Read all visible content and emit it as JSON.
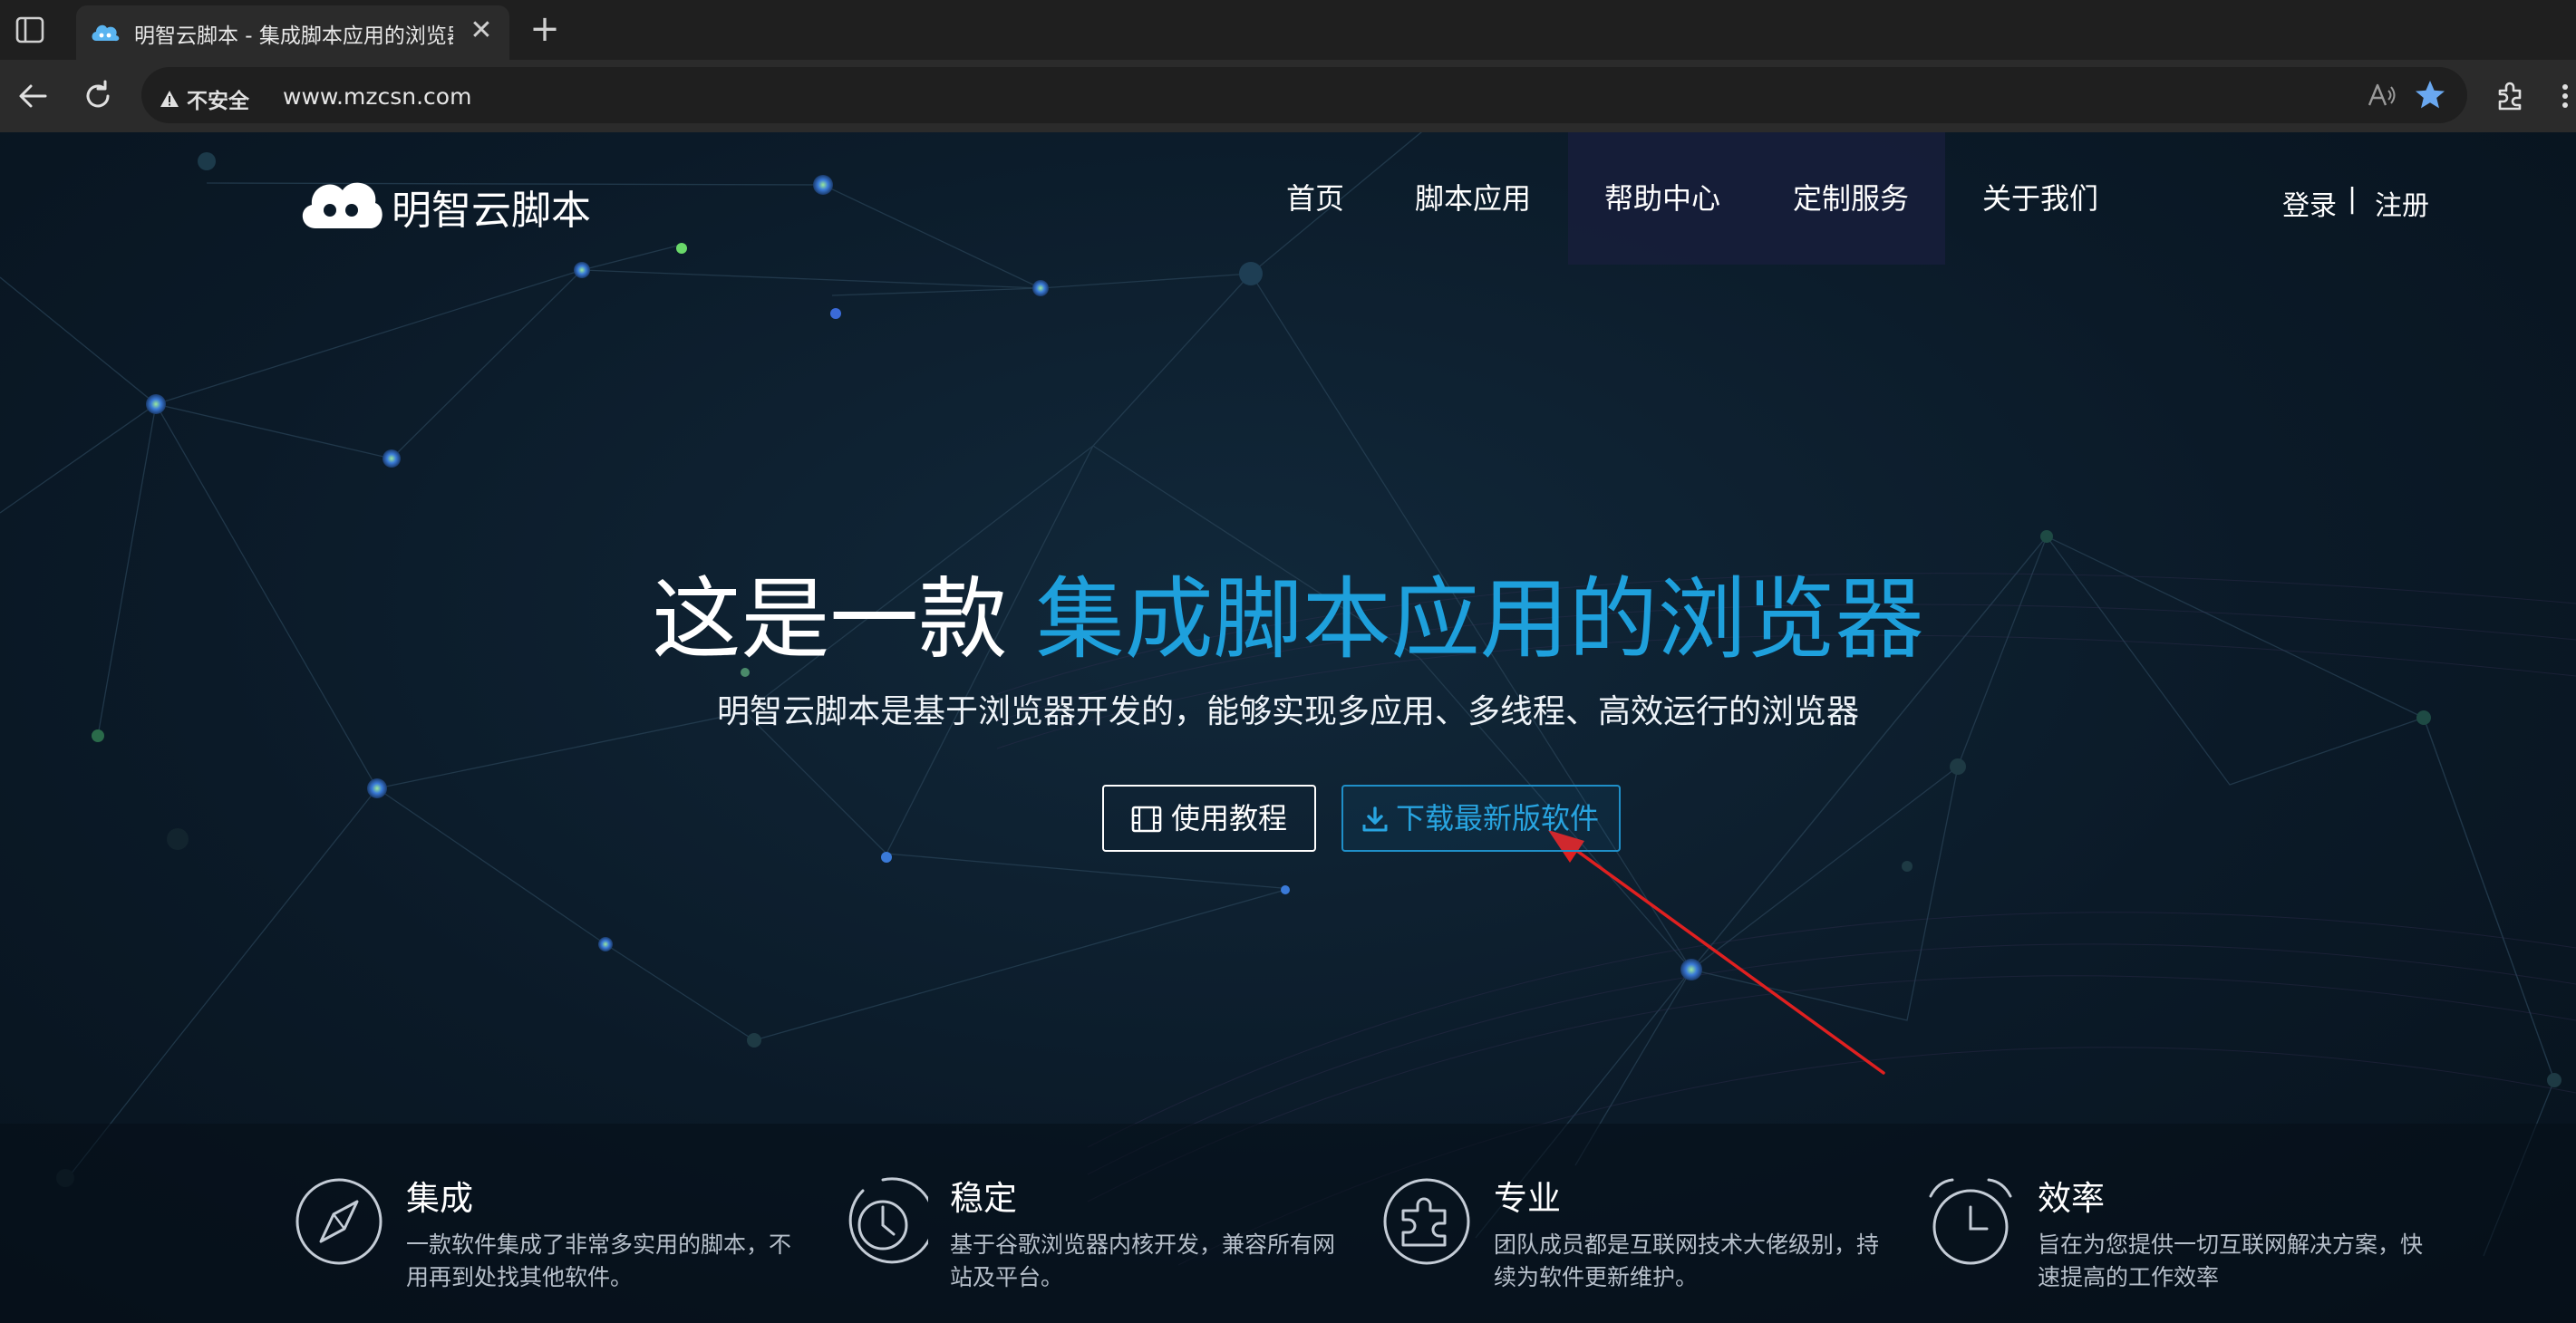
{
  "browser": {
    "tab_title": "明智云脚本 - 集成脚本应用的浏览器",
    "tab_close": "✕",
    "new_tab": "+",
    "security_label": "不安全",
    "url": "www.mzcsn.com"
  },
  "header": {
    "logo_text": "明智云脚本",
    "nav": [
      "首页",
      "脚本应用",
      "帮助中心",
      "定制服务",
      "关于我们"
    ],
    "login": "登录",
    "separator": "|",
    "register": "注册"
  },
  "hero": {
    "title_white": "这是一款",
    "title_highlight": "集成脚本应用的浏览器",
    "subtitle": "明智云脚本是基于浏览器开发的，能够实现多应用、多线程、高效运行的浏览器",
    "btn_tutorial": "使用教程",
    "btn_download": "下载最新版软件"
  },
  "features": [
    {
      "title": "集成",
      "desc": "一款软件集成了非常多实用的脚本，不用再到处找其他软件。"
    },
    {
      "title": "稳定",
      "desc": "基于谷歌浏览器内核开发，兼容所有网站及平台。"
    },
    {
      "title": "专业",
      "desc": "团队成员都是互联网技术大佬级别，持续为软件更新维护。"
    },
    {
      "title": "效率",
      "desc": "旨在为您提供一切互联网解决方案，快速提高的工作效率"
    }
  ],
  "colors": {
    "accent": "#1ea0dc",
    "annotation_arrow": "#e02020"
  }
}
